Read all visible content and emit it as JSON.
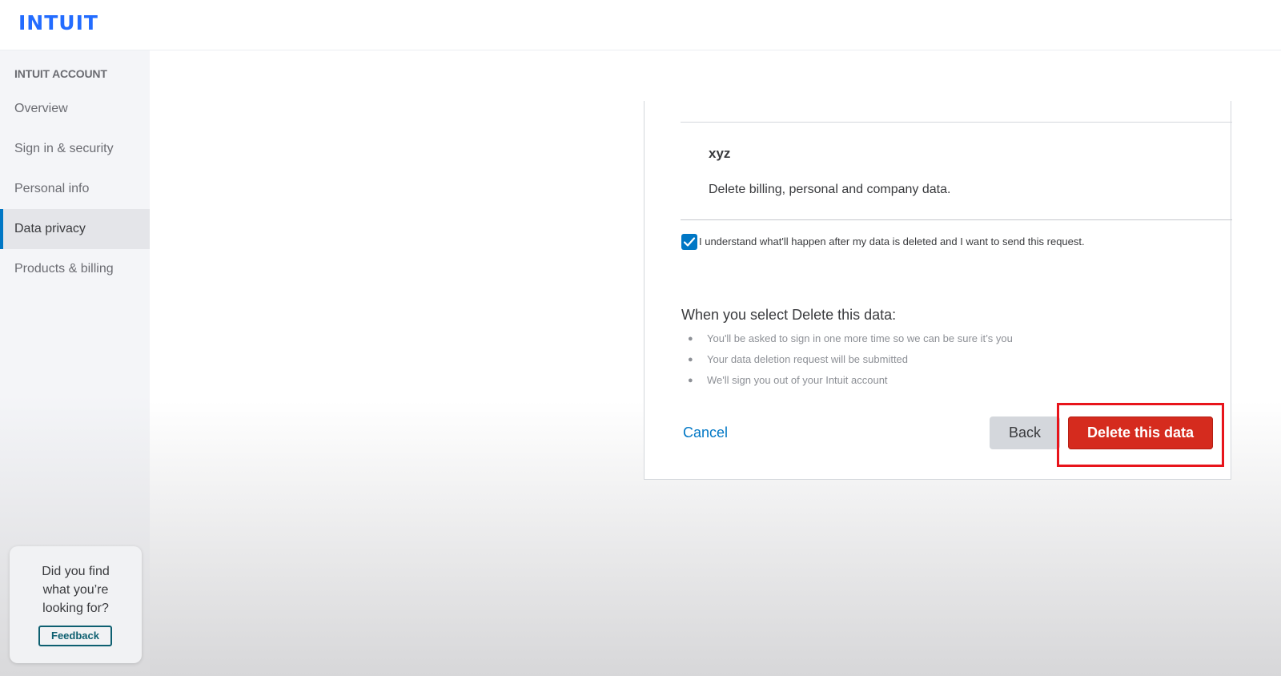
{
  "header": {
    "logo_text": "INTUIT"
  },
  "sidebar": {
    "heading": "INTUIT ACCOUNT",
    "items": [
      {
        "label": "Overview"
      },
      {
        "label": "Sign in & security"
      },
      {
        "label": "Personal info"
      },
      {
        "label": "Data privacy",
        "active": true
      },
      {
        "label": "Products & billing"
      }
    ],
    "feedback": {
      "prompt": "Did you find what you’re looking for?",
      "button": "Feedback"
    }
  },
  "main": {
    "account_name": "xyz",
    "account_description": "Delete billing, personal and company data.",
    "confirm_checkbox": {
      "checked": true,
      "label": "I understand what'll happen after my data is deleted and I want to send this request."
    },
    "section_title": "When you select Delete this data:",
    "bullets": [
      "You'll be asked to sign in one more time so we can be sure it’s you",
      "Your data deletion request will be submitted",
      "We'll sign you out of your Intuit account"
    ],
    "actions": {
      "cancel": "Cancel",
      "back": "Back",
      "delete": "Delete this data"
    }
  },
  "colors": {
    "brand_blue": "#236cff",
    "link_blue": "#0077c5",
    "danger_red": "#d52b1e",
    "highlight_red": "#e8141b"
  }
}
